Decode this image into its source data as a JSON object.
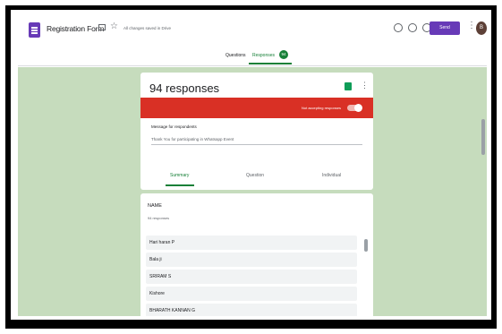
{
  "header": {
    "title": "Registration Form",
    "save_status": "All changes saved in Drive",
    "send_label": "Send",
    "avatar_initial": "B"
  },
  "tabs": {
    "questions": "Questions",
    "responses": "Responses",
    "response_count": "94"
  },
  "summary_card": {
    "title": "94 responses",
    "accepting_label": "Not accepting responses",
    "message_label": "Message for respondents",
    "message_text": "Thank You for participating in Whatsapp Event",
    "subtabs": [
      "Summary",
      "Question",
      "Individual"
    ]
  },
  "question_card": {
    "title": "NAME",
    "count": "94 responses",
    "answers": [
      "Hari haran P",
      "Bala ji",
      "SRIRAM S",
      "Kishore",
      "BHARATH KANNAN G"
    ]
  },
  "colors": {
    "accent": "#673ab7",
    "responses_green": "#188038",
    "banner_red": "#d93025",
    "background": "#c6dcbd"
  },
  "icons": [
    "forms-logo-icon",
    "folder-icon",
    "star-icon",
    "palette-icon",
    "preview-icon",
    "settings-icon",
    "sheets-icon",
    "more-vert-icon"
  ]
}
